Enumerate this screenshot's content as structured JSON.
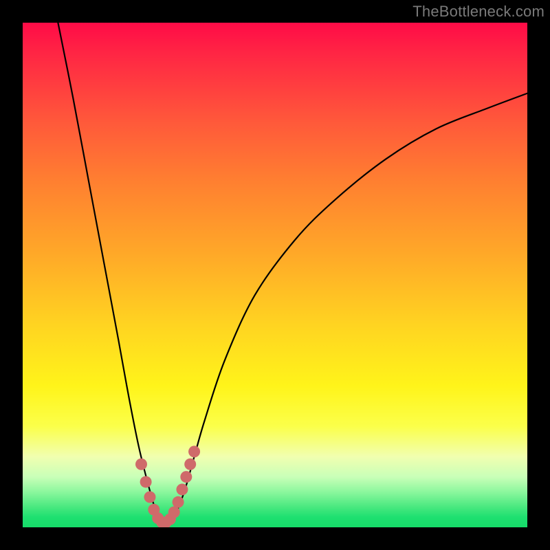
{
  "watermark": "TheBottleneck.com",
  "colors": {
    "background": "#000000",
    "curve_stroke": "#000000",
    "marker_stroke": "#cf6a6a",
    "marker_fill": "#cf6a6a"
  },
  "chart_data": {
    "type": "line",
    "title": "",
    "xlabel": "",
    "ylabel": "",
    "xlim": [
      0,
      100
    ],
    "ylim": [
      0,
      100
    ],
    "grid": false,
    "legend": false,
    "series": [
      {
        "name": "curve",
        "x": [
          7,
          10,
          13,
          16,
          19,
          21,
          23,
          25,
          26.5,
          28,
          29,
          30,
          32,
          34,
          36,
          40,
          46,
          54,
          62,
          72,
          82,
          92,
          100
        ],
        "y": [
          100,
          85,
          69,
          53,
          37,
          26,
          16,
          8,
          3,
          1,
          1,
          2,
          7,
          14,
          21,
          33,
          46,
          57,
          65,
          73,
          79,
          83,
          86
        ]
      }
    ],
    "markers": {
      "name": "highlight",
      "x": [
        23.5,
        24.4,
        25.2,
        26.0,
        26.8,
        27.6,
        28.4,
        29.2,
        30.0,
        30.8,
        31.6,
        32.4,
        33.2,
        34.0
      ],
      "y": [
        12.5,
        9.0,
        6.0,
        3.5,
        1.8,
        1.0,
        1.0,
        1.6,
        3.0,
        5.0,
        7.5,
        10.0,
        12.5,
        15.0
      ]
    }
  }
}
